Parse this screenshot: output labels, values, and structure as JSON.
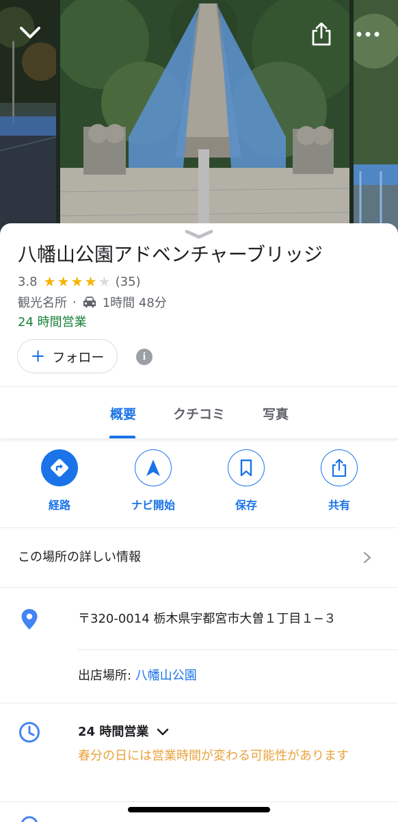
{
  "gallery": {
    "photos": [
      "night-bridge-photo",
      "suspension-bridge-photo",
      "bridge-side-photo"
    ]
  },
  "place": {
    "title": "八幡山公園アドベンチャーブリッジ",
    "rating": "3.8",
    "stars_filled": 4,
    "review_count": "(35)",
    "category": "観光名所",
    "separator": "·",
    "drive_time": "1時間 48分",
    "hours_status": "24 時間営業"
  },
  "follow": {
    "plus": "+",
    "label": "フォロー"
  },
  "info_icon_glyph": "i",
  "tabs": [
    {
      "label": "概要",
      "active": true
    },
    {
      "label": "クチコミ",
      "active": false
    },
    {
      "label": "写真",
      "active": false
    }
  ],
  "actions": [
    {
      "label": "経路",
      "icon": "directions-icon"
    },
    {
      "label": "ナビ開始",
      "icon": "navigation-arrow-icon"
    },
    {
      "label": "保存",
      "icon": "bookmark-icon"
    },
    {
      "label": "共有",
      "icon": "share-icon"
    }
  ],
  "details_link": "この場所の詳しい情報",
  "address": "〒320-0014 栃木県宇都宮市大曽１丁目１−３",
  "located_in": {
    "prefix": "出店場所: ",
    "place": "八幡山公園"
  },
  "hours": {
    "title": "24 時間営業",
    "note": "春分の日には営業時間が変わる可能性があります"
  },
  "colors": {
    "accent": "#1a73e8",
    "open_green": "#188038",
    "star": "#f4b400",
    "warning": "#e8a33c"
  }
}
